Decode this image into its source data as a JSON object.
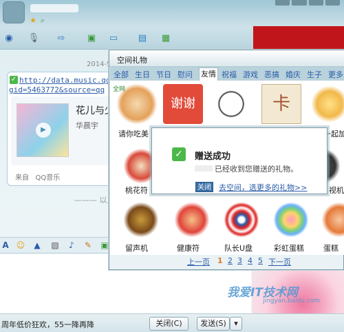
{
  "chat": {
    "timestamp": "2014-5",
    "message": {
      "link_line1": "http://data.music.qq",
      "link_line2": "gid=5463772&source=qq",
      "song_title": "花儿与少",
      "singer": "华晨宇",
      "source_prefix": "来自",
      "source_app": "QQ音乐",
      "play_icon": "play-icon"
    },
    "divider_text": "以上",
    "promo_text": "周年低价狂欢，55一降再降",
    "close_button": "关闭(C)",
    "send_button": "发送(S)",
    "send_arrow": "▾"
  },
  "gift_dialog": {
    "title": "空间礼物",
    "tabs": [
      "全部",
      "生日",
      "节日",
      "慰问",
      "友情",
      "祝福",
      "游戏",
      "恶搞",
      "婚庆",
      "生子",
      "更多"
    ],
    "active_tab": "友情",
    "gifts_row1": [
      "请你吃美",
      "",
      "",
      "",
      "一起加"
    ],
    "gifts_row2": [
      "桃花符",
      "",
      "",
      "",
      "视机"
    ],
    "gifts_row3": [
      "留声机",
      "健康符",
      "队长U盘",
      "彩虹蛋糕",
      "蛋糕"
    ],
    "badge": "全网",
    "card_text_1": "谢谢",
    "card_text_2": "卡",
    "pager": {
      "prev": "上一页",
      "pages": [
        "1",
        "2",
        "3",
        "4",
        "5"
      ],
      "current": "1",
      "next": "下一页"
    }
  },
  "popup": {
    "title": "赠送成功",
    "message": "已经收到您赠送的礼物。",
    "close_button": "关闭",
    "more_link": "去空间，选更多的礼物>>"
  },
  "watermark": {
    "text": "我爱IT技术网",
    "url": "jingyan.baidu.com"
  },
  "colors": {
    "accent_blue": "#2a5ca8",
    "success_green": "#4db84a",
    "ad_red": "#c0161b"
  }
}
